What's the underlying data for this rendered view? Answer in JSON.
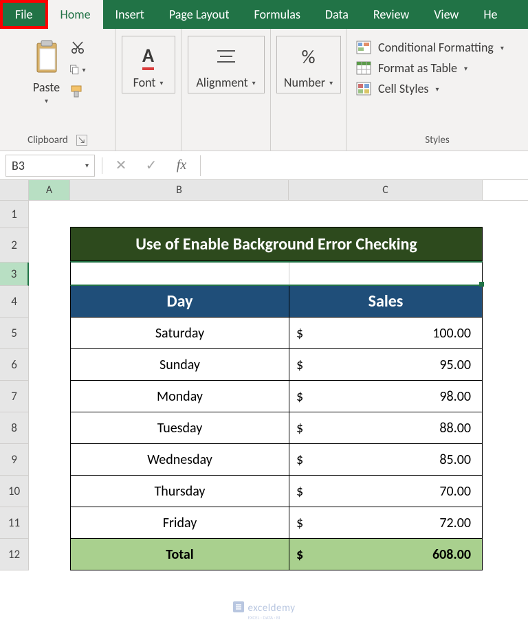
{
  "tabs": {
    "file": "File",
    "home": "Home",
    "insert": "Insert",
    "page_layout": "Page Layout",
    "formulas": "Formulas",
    "data": "Data",
    "review": "Review",
    "view": "View",
    "help_partial": "He"
  },
  "ribbon": {
    "clipboard": {
      "paste_label": "Paste",
      "group_label": "Clipboard"
    },
    "font": {
      "label": "Font"
    },
    "alignment": {
      "label": "Alignment"
    },
    "number": {
      "label": "Number",
      "icon": "%"
    },
    "styles": {
      "cond_fmt": "Conditional Formatting",
      "fmt_table": "Format as Table",
      "cell_styles": "Cell Styles",
      "group_label": "Styles"
    }
  },
  "namebar": {
    "cell_ref": "B3",
    "fx_label": "fx"
  },
  "columns": {
    "a": "A",
    "b": "B",
    "c": "C"
  },
  "row_nums": [
    "1",
    "2",
    "3",
    "4",
    "5",
    "6",
    "7",
    "8",
    "9",
    "10",
    "11",
    "12"
  ],
  "table": {
    "title": "Use of Enable Background Error Checking",
    "header_day": "Day",
    "header_sales": "Sales",
    "rows": [
      {
        "day": "Saturday",
        "cur": "$",
        "val": "100.00"
      },
      {
        "day": "Sunday",
        "cur": "$",
        "val": "95.00"
      },
      {
        "day": "Monday",
        "cur": "$",
        "val": "98.00"
      },
      {
        "day": "Tuesday",
        "cur": "$",
        "val": "88.00"
      },
      {
        "day": "Wednesday",
        "cur": "$",
        "val": "85.00"
      },
      {
        "day": "Thursday",
        "cur": "$",
        "val": "70.00"
      },
      {
        "day": "Friday",
        "cur": "$",
        "val": "72.00"
      }
    ],
    "total_label": "Total",
    "total_cur": "$",
    "total_val": "608.00"
  },
  "watermark": {
    "brand": "exceldemy",
    "sub": "EXCEL · DATA · BI"
  }
}
